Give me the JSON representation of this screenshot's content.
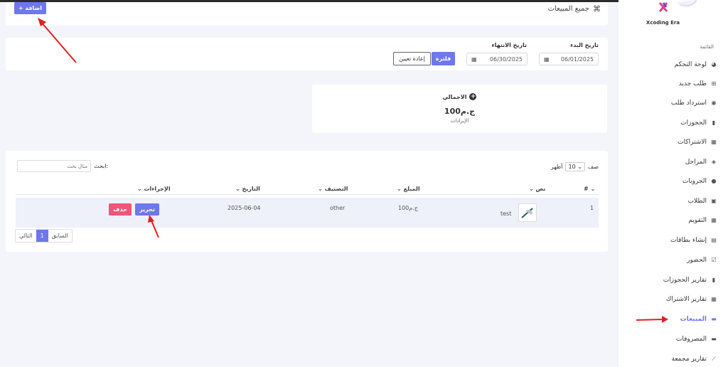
{
  "header": {
    "title": "جميع المبيعات",
    "add_label": "+ اضافة"
  },
  "filters": {
    "start_label": "تاريخ البدء",
    "end_label": "تاريخ الانتهاء",
    "start_value": "06/01/2025",
    "end_value": "06/30/2025",
    "filter_label": "فلترة",
    "reset_label": "إعادة تعيين"
  },
  "summary": {
    "title": "الاجمالي",
    "amount": "ج.م100",
    "caption": "الإيرادات"
  },
  "table": {
    "show_label": "أظهر",
    "per_page": "10",
    "rows_label": "صف",
    "search_label": "ابحث:",
    "search_placeholder": "مثال بحث",
    "headers": [
      "#",
      "نص",
      "المبلغ",
      "التصنيف",
      "التاريخ",
      "الإجراءات"
    ],
    "rows": [
      {
        "num": "1",
        "text": "test",
        "amount": "ج.م100",
        "category": "other",
        "date": "2025-06-04",
        "edit": "تحرير",
        "delete": "حذف"
      }
    ],
    "pagination": {
      "prev": "السابق",
      "page": "1",
      "next": "التالي"
    }
  },
  "sidebar": {
    "brand": "Xcoding Era",
    "menu_title": "القائمة",
    "items": [
      {
        "label": "لوحة التحكم",
        "icon": "dashboard-icon"
      },
      {
        "label": "طلب جديد",
        "icon": "cart-icon"
      },
      {
        "label": "استرداد طلب",
        "icon": "return-icon"
      },
      {
        "label": "الحجوزات",
        "icon": "book-icon"
      },
      {
        "label": "الاشتراكات",
        "icon": "calendar-icon"
      },
      {
        "label": "المراحل",
        "icon": "layers-icon"
      },
      {
        "label": "الجروبات",
        "icon": "users-icon"
      },
      {
        "label": "الطلاب",
        "icon": "student-icon"
      },
      {
        "label": "التقويم",
        "icon": "calendar-icon"
      },
      {
        "label": "إنشاء بطاقات",
        "icon": "id-card-icon"
      },
      {
        "label": "الحضور",
        "icon": "check-calendar-icon"
      },
      {
        "label": "تقارير الحجوزات",
        "icon": "book-icon"
      },
      {
        "label": "تقارير الاشتراك",
        "icon": "calendar-icon"
      },
      {
        "label": "المبيعات",
        "icon": "money-icon"
      },
      {
        "label": "المصروفات",
        "icon": "money-icon"
      },
      {
        "label": "تقارير مجمعة",
        "icon": "chart-icon"
      }
    ]
  },
  "colors": {
    "accent": "#6e78ea",
    "danger": "#f0557a",
    "arrow": "#e02020"
  }
}
